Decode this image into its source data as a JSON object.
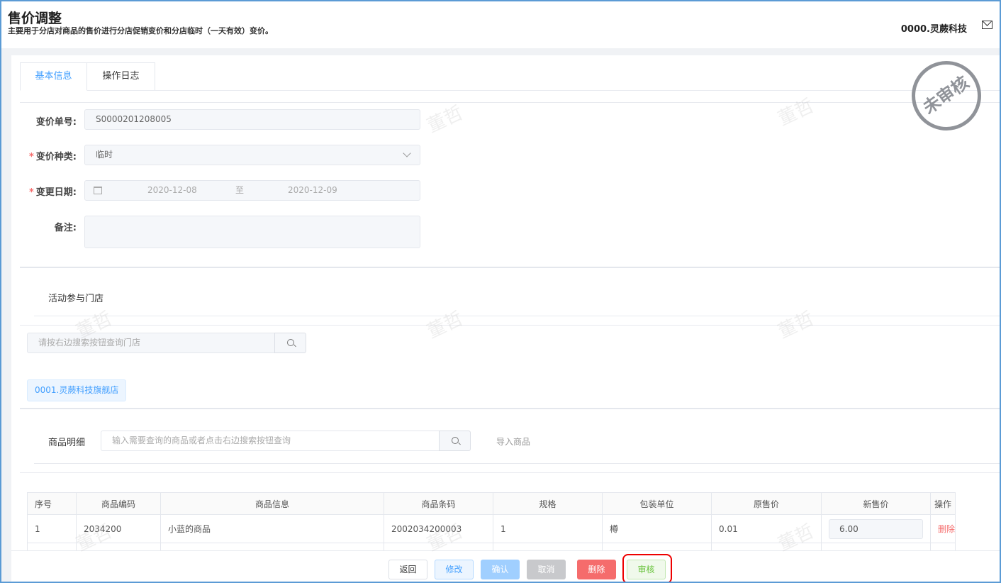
{
  "header": {
    "title": "售价调整",
    "subtitle": "主要用于分店对商品的售价进行分店促销变价和分店临时（一天有效）变价。",
    "company": "0000.灵蕨科技"
  },
  "tabs": [
    {
      "label": "基本信息",
      "active": true
    },
    {
      "label": "操作日志"
    }
  ],
  "stamp": "未审核",
  "watermark": "董哲",
  "form": {
    "order_no_label": "变价单号:",
    "order_no": "S0000201208005",
    "type_label": "变价种类:",
    "type_value": "临时",
    "date_label": "变更日期:",
    "date_start": "2020-12-08",
    "date_sep": "至",
    "date_end": "2020-12-09",
    "remark_label": "备注:",
    "remark": ""
  },
  "stores": {
    "title": "活动参与门店",
    "search_placeholder": "请按右边搜索按钮查询门店",
    "tags": [
      "0001.灵蕨科技旗舰店"
    ]
  },
  "products": {
    "title": "商品明细",
    "search_placeholder": "输入需要查询的商品或者点击右边搜索按钮查询",
    "import_label": "导入商品",
    "columns": [
      "序号",
      "商品编码",
      "商品信息",
      "商品条码",
      "规格",
      "包装单位",
      "原售价",
      "新售价",
      "操作"
    ],
    "rows": [
      {
        "no": "1",
        "code": "2034200",
        "info": "小蓝的商品",
        "barcode": "2002034200003",
        "spec": "1",
        "unit": "樽",
        "old_price": "0.01",
        "new_price": "6.00",
        "action": "删除"
      }
    ]
  },
  "footer": {
    "back": "返回",
    "edit": "修改",
    "confirm": "确认",
    "cancel": "取消",
    "delete": "删除",
    "audit": "审核"
  },
  "colors": {
    "accent": "#409eff",
    "danger": "#f56c6c",
    "success": "#67c23a",
    "frame": "#5b9bd5"
  }
}
